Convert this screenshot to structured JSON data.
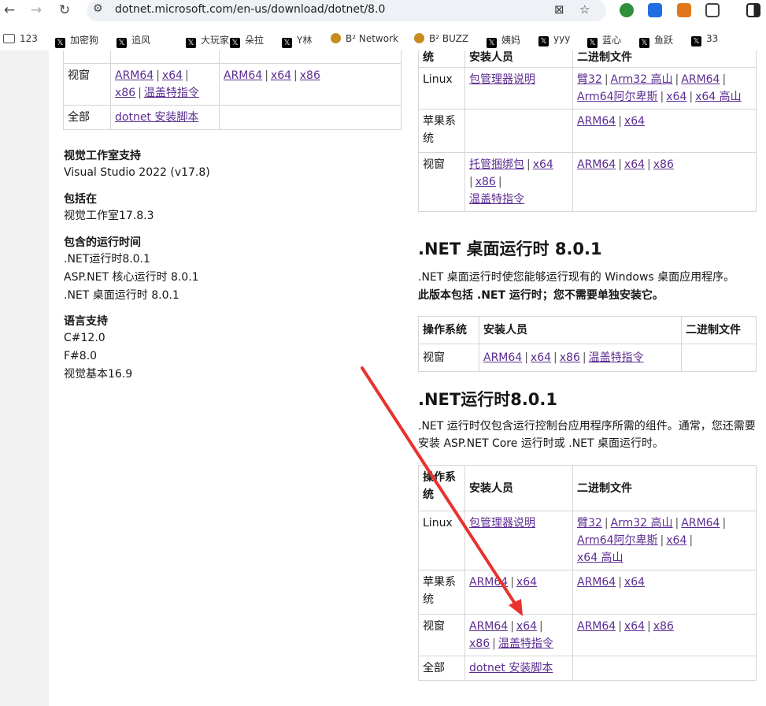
{
  "browser": {
    "url": "dotnet.microsoft.com/en-us/download/dotnet/8.0",
    "bookmarks": [
      {
        "label": "123",
        "icon": "folder"
      },
      {
        "label": "加密狗",
        "icon": "x"
      },
      {
        "label": "追风",
        "icon": "x"
      },
      {
        "label": "大玩家",
        "icon": "x"
      },
      {
        "label": "朵拉",
        "icon": "x"
      },
      {
        "label": "Y林",
        "icon": "x"
      },
      {
        "label": "B² Network",
        "icon": "coin"
      },
      {
        "label": "B² BUZZ",
        "icon": "coin"
      },
      {
        "label": "姨妈",
        "icon": "x"
      },
      {
        "label": "yyy",
        "icon": "x"
      },
      {
        "label": "蓝心",
        "icon": "x"
      },
      {
        "label": "鱼跃",
        "icon": "x"
      },
      {
        "label": "33",
        "icon": "x"
      }
    ]
  },
  "left": {
    "top_table": {
      "row_windows": {
        "os": "视窗",
        "installer": [
          "ARM64",
          "x64",
          "x86",
          "温盖特指令"
        ],
        "binaries": [
          "ARM64",
          "x64",
          "x86"
        ]
      },
      "row_all": {
        "os": "全部",
        "installer_link": "dotnet 安装脚本"
      }
    },
    "vs_support_label": "视觉工作室支持",
    "vs_support_value": "Visual Studio 2022 (v17.8)",
    "included_in_label": "包括在",
    "included_in_value": "视觉工作室17.8.3",
    "runtimes_label": "包含的运行时间",
    "runtimes": [
      ".NET运行时8.0.1",
      "ASP.NET 核心运行时 8.0.1",
      ".NET 桌面运行时 8.0.1"
    ],
    "lang_label": "语言支持",
    "langs": [
      "C#12.0",
      "F#8.0",
      "视觉基本16.9"
    ]
  },
  "right": {
    "aspnet_table": {
      "headers": [
        "统",
        "安装人员",
        "二进制文件"
      ],
      "linux": {
        "os": "Linux",
        "installer": "包管理器说明",
        "binaries": [
          "臂32",
          "Arm32 高山",
          "ARM64",
          "Arm64阿尔卑斯",
          "x64",
          "x64 高山"
        ]
      },
      "mac": {
        "os": "苹果系统",
        "binaries": [
          "ARM64",
          "x64"
        ]
      },
      "windows": {
        "os": "视窗",
        "installer": [
          "托管捆绑包",
          "x64",
          "x86",
          "温盖特指令"
        ],
        "binaries": [
          "ARM64",
          "x64",
          "x86"
        ]
      }
    },
    "desktop": {
      "title": ".NET 桌面运行时 8.0.1",
      "desc": ".NET 桌面运行时使您能够运行现有的 Windows 桌面应用程序。",
      "note": "此版本包括 .NET 运行时；您不需要单独安装它。",
      "headers": [
        "操作系统",
        "安装人员",
        "二进制文件"
      ],
      "windows": {
        "os": "视窗",
        "installer": [
          "ARM64",
          "x64",
          "x86",
          "温盖特指令"
        ]
      }
    },
    "runtime": {
      "title": ".NET运行时8.0.1",
      "desc": ".NET 运行时仅包含运行控制台应用程序所需的组件。通常，您还需要安装 ASP.NET Core 运行时或 .NET 桌面运行时。",
      "headers": [
        "操作系统",
        "安装人员",
        "二进制文件"
      ],
      "linux": {
        "os": "Linux",
        "installer": "包管理器说明",
        "binaries": [
          "臂32",
          "Arm32 高山",
          "ARM64",
          "Arm64阿尔卑斯",
          "x64",
          "x64 高山"
        ]
      },
      "mac": {
        "os": "苹果系统",
        "installer": [
          "ARM64",
          "x64"
        ],
        "binaries": [
          "ARM64",
          "x64"
        ]
      },
      "windows": {
        "os": "视窗",
        "installer": [
          "ARM64",
          "x64",
          "x86",
          "温盖特指令"
        ],
        "binaries": [
          "ARM64",
          "x64",
          "x86"
        ]
      },
      "all": {
        "os": "全部",
        "installer_link": "dotnet 安装脚本"
      }
    }
  },
  "colors": {
    "link": "#5c2d91",
    "annotation_arrow": "#e8322d"
  }
}
